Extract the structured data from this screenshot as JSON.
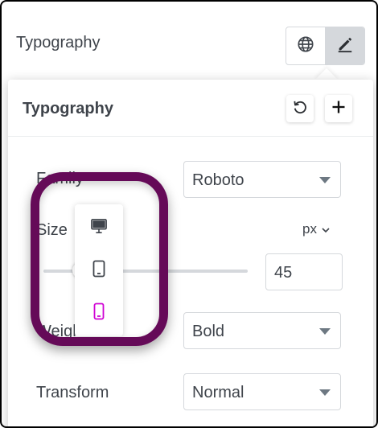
{
  "top": {
    "label": "Typography",
    "toggle": [
      {
        "icon": "globe-icon",
        "active": false
      },
      {
        "icon": "pencil-icon",
        "active": true
      }
    ]
  },
  "popover": {
    "title": "Typography",
    "buttons": [
      {
        "icon": "reset-icon"
      },
      {
        "icon": "plus-icon"
      }
    ],
    "family": {
      "label": "Family",
      "value": "Roboto"
    },
    "size": {
      "label": "Size",
      "unit": "px",
      "value": "45"
    },
    "weight": {
      "label": "Weight",
      "value": "Bold"
    },
    "transform": {
      "label": "Transform",
      "value": "Normal"
    },
    "device_menu": {
      "items": [
        {
          "icon": "desktop-icon",
          "active": false
        },
        {
          "icon": "tablet-icon",
          "active": false
        },
        {
          "icon": "mobile-icon",
          "active": true
        }
      ]
    }
  },
  "colors": {
    "text": "#3f444b",
    "border": "#d5d8dc",
    "active_toggle": "#d5d8dc",
    "highlight": "#650a58",
    "active_device": "#d004d4"
  }
}
